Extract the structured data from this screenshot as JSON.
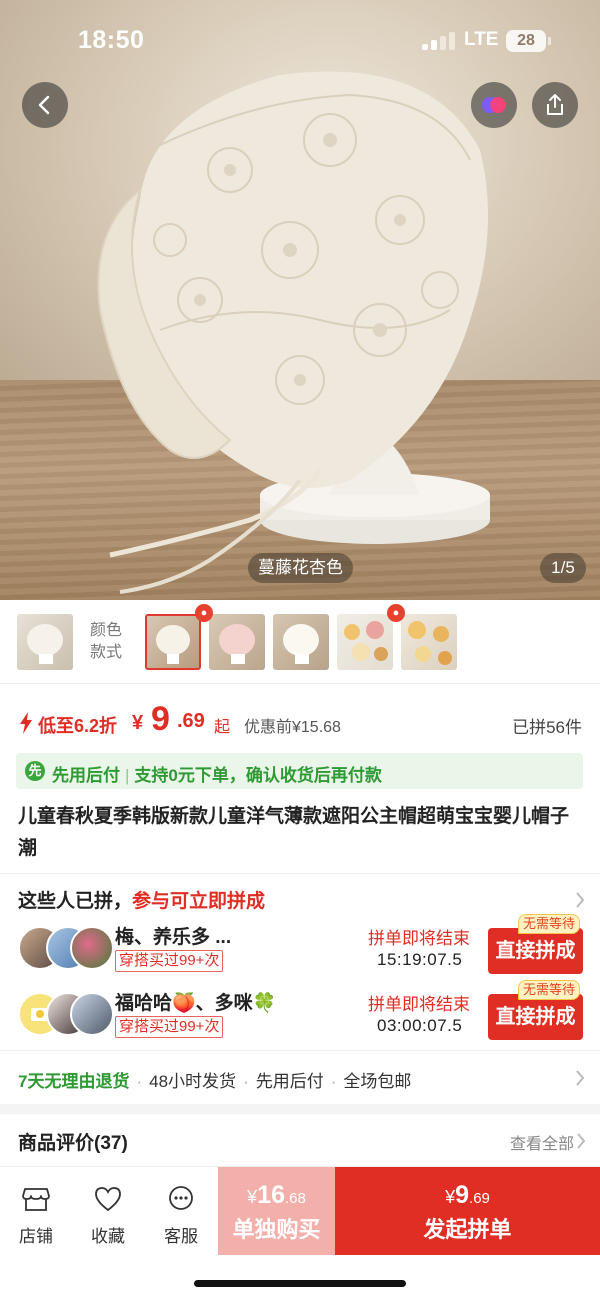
{
  "status_bar": {
    "time": "18:50",
    "network": "LTE",
    "battery": "28"
  },
  "hero": {
    "color_tag": "蔓藤花杏色",
    "page_indicator": "1/5"
  },
  "variants": {
    "label_line1": "颜色",
    "label_line2": "款式"
  },
  "price": {
    "discount": "低至6.2折",
    "currency": "¥",
    "integer": "9",
    "decimal": ".69",
    "suffix": "起",
    "original": "优惠前¥15.68",
    "sold": "已拼56件"
  },
  "bnpl": {
    "icon_text": "先",
    "part1": "先用后付",
    "part2": "支持0元下单，确认收货后再付款"
  },
  "title": "儿童春秋夏季韩版新款儿童洋气薄款遮阳公主帽超萌宝宝婴儿帽子潮",
  "group_buy": {
    "heading": "这些人已拼，",
    "heading_highlight": "参与可立即拼成",
    "rows": [
      {
        "names": "梅、养乐多 ...",
        "badge": "穿搭买过99+次",
        "end_label": "拼单即将结束",
        "countdown": "15:19:07.5",
        "no_wait": "无需等待",
        "button": "直接拼成"
      },
      {
        "names": "福哈哈🍑、多咪🍀",
        "badge": "穿搭买过99+次",
        "end_label": "拼单即将结束",
        "countdown": "03:00:07.5",
        "no_wait": "无需等待",
        "button": "直接拼成"
      }
    ]
  },
  "services": {
    "return_policy": "7天无理由退货",
    "items": [
      "48小时发货",
      "先用后付",
      "全场包邮"
    ]
  },
  "reviews": {
    "heading": "商品评价(37)",
    "view_all": "查看全部"
  },
  "bottom_bar": {
    "store": "店铺",
    "favorite": "收藏",
    "service": "客服",
    "solo_price_currency": "¥",
    "solo_price_int": "16",
    "solo_price_dec": ".68",
    "solo_label": "单独购买",
    "group_price_currency": "¥",
    "group_price_int": "9",
    "group_price_dec": ".69",
    "group_label": "发起拼单"
  },
  "colors": {
    "accent": "#e02e24",
    "green": "#2f9a34"
  }
}
